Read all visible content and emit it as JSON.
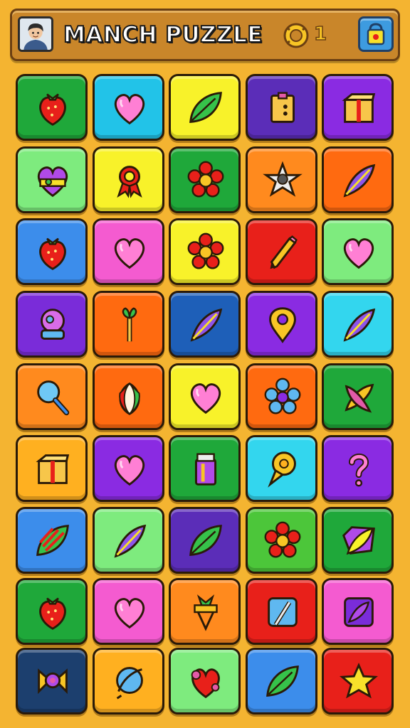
{
  "header": {
    "title": "MANCH PUZZLE",
    "coin_count": "1",
    "avatar_icon": "player-avatar",
    "coin_icon": "coin-icon",
    "shop_icon": "shop-bag-icon"
  },
  "board": {
    "rows": 9,
    "cols": 5,
    "tiles": [
      {
        "color": "#1FA83A",
        "icon": "strawberry"
      },
      {
        "color": "#22C3E8",
        "icon": "heart"
      },
      {
        "color": "#F8F22A",
        "icon": "leaf"
      },
      {
        "color": "#5B2DB8",
        "icon": "box"
      },
      {
        "color": "#8A2BE2",
        "icon": "gift-box"
      },
      {
        "color": "#7EEB7E",
        "icon": "heart-badge"
      },
      {
        "color": "#F8F22A",
        "icon": "ribbon"
      },
      {
        "color": "#1FA83A",
        "icon": "flower"
      },
      {
        "color": "#FF8A1E",
        "icon": "star-gear"
      },
      {
        "color": "#FF6A10",
        "icon": "feather"
      },
      {
        "color": "#3C8DEB",
        "icon": "strawberry"
      },
      {
        "color": "#F45BD0",
        "icon": "heart"
      },
      {
        "color": "#F8F22A",
        "icon": "flower"
      },
      {
        "color": "#E8201A",
        "icon": "pencil"
      },
      {
        "color": "#7EEB7E",
        "icon": "heart"
      },
      {
        "color": "#7A2CD9",
        "icon": "snow-globe"
      },
      {
        "color": "#FF6A10",
        "icon": "sprout-pin"
      },
      {
        "color": "#1E5FB8",
        "icon": "feather"
      },
      {
        "color": "#8A2BE2",
        "icon": "map-pin"
      },
      {
        "color": "#33D6EE",
        "icon": "feather"
      },
      {
        "color": "#FF8A1E",
        "icon": "magnifier"
      },
      {
        "color": "#FF6A10",
        "icon": "seed"
      },
      {
        "color": "#F8F22A",
        "icon": "heart"
      },
      {
        "color": "#FF6A10",
        "icon": "flower-gear"
      },
      {
        "color": "#1FA83A",
        "icon": "cross-leaves"
      },
      {
        "color": "#FFB020",
        "icon": "gift-box"
      },
      {
        "color": "#8A2BE2",
        "icon": "heart"
      },
      {
        "color": "#1FA83A",
        "icon": "jar"
      },
      {
        "color": "#33D6EE",
        "icon": "chat-pin"
      },
      {
        "color": "#8A2BE2",
        "icon": "question-mark"
      },
      {
        "color": "#3C8DEB",
        "icon": "striped-leaf"
      },
      {
        "color": "#7EEB7E",
        "icon": "feather"
      },
      {
        "color": "#5B2DB8",
        "icon": "leaf"
      },
      {
        "color": "#4CC63A",
        "icon": "flower"
      },
      {
        "color": "#1FA83A",
        "icon": "feather-badge"
      },
      {
        "color": "#1FA83A",
        "icon": "strawberry"
      },
      {
        "color": "#F45BD0",
        "icon": "heart"
      },
      {
        "color": "#FF8A1E",
        "icon": "carrot-pot"
      },
      {
        "color": "#E8201A",
        "icon": "brush-card"
      },
      {
        "color": "#F45BD0",
        "icon": "feather-card"
      },
      {
        "color": "#1C3F6E",
        "icon": "bow-gem"
      },
      {
        "color": "#FFB020",
        "icon": "feather-ball"
      },
      {
        "color": "#7EEB7E",
        "icon": "heart-splat"
      },
      {
        "color": "#3C8DEB",
        "icon": "leaf"
      },
      {
        "color": "#E8201A",
        "icon": "star"
      }
    ]
  }
}
